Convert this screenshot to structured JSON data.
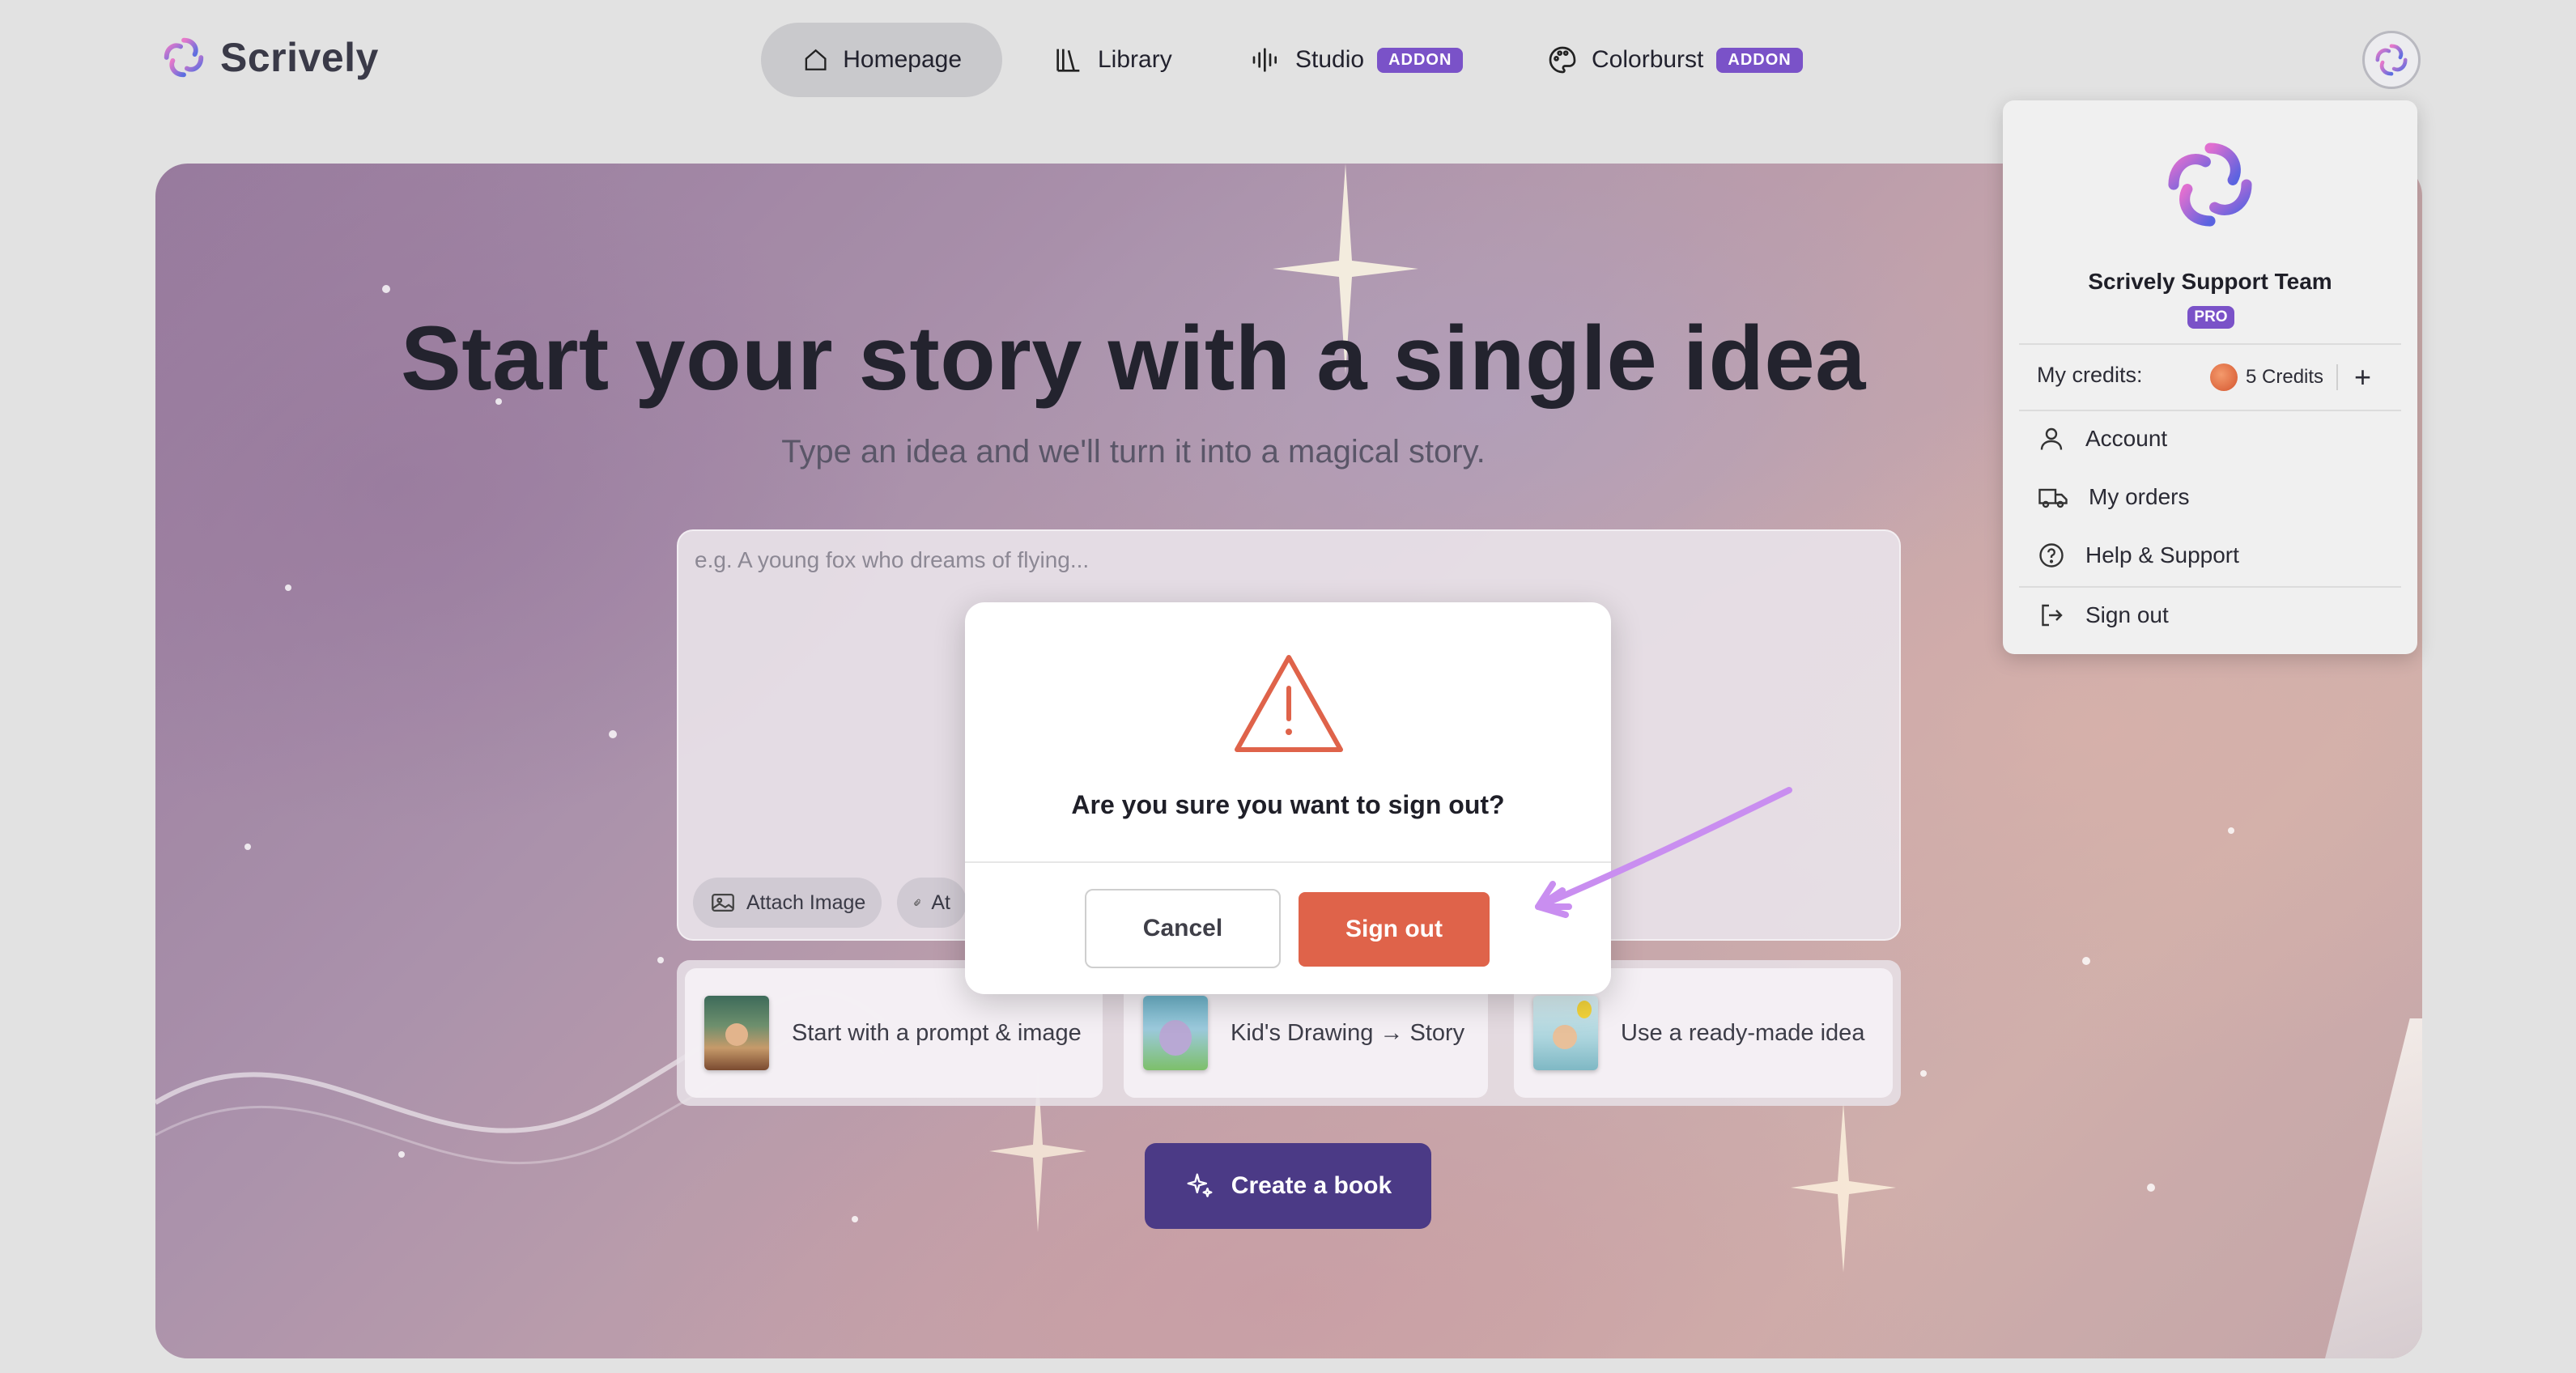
{
  "app": {
    "name": "Scrively"
  },
  "nav": {
    "items": [
      {
        "label": "Homepage",
        "icon": "home-icon",
        "active": true
      },
      {
        "label": "Library",
        "icon": "library-icon",
        "active": false
      },
      {
        "label": "Studio",
        "icon": "audio-wave-icon",
        "badge": "ADDON",
        "active": false
      },
      {
        "label": "Colorburst",
        "icon": "palette-icon",
        "badge": "ADDON",
        "active": false
      }
    ]
  },
  "hero": {
    "title": "Start your story with a single idea",
    "subtitle": "Type an idea and we'll turn it into a magical story.",
    "prompt_placeholder": "e.g. A young fox who dreams of flying...",
    "chips": [
      {
        "label": "Attach Image",
        "icon": "image-icon"
      },
      {
        "label": "At",
        "icon": "paperclip-icon"
      }
    ],
    "options": [
      {
        "label": "Start with a prompt & image"
      },
      {
        "label": "Kid's Drawing → Story"
      },
      {
        "label": "Use a ready-made idea"
      }
    ],
    "create_button": "Create a book"
  },
  "user_menu": {
    "name": "Scrively Support Team",
    "plan_badge": "PRO",
    "credits_label": "My credits:",
    "credits_value": "5 Credits",
    "items": [
      {
        "label": "Account",
        "icon": "user-icon"
      },
      {
        "label": "My orders",
        "icon": "truck-icon"
      },
      {
        "label": "Help & Support",
        "icon": "help-circle-icon"
      },
      {
        "label": "Sign out",
        "icon": "logout-icon"
      }
    ]
  },
  "modal": {
    "question": "Are you sure you want to sign out?",
    "cancel_label": "Cancel",
    "confirm_label": "Sign out"
  },
  "colors": {
    "accent_purple": "#7a52c8",
    "create_button": "#4b3a86",
    "danger": "#df634a",
    "annotation_arrow": "#c98ef0"
  }
}
